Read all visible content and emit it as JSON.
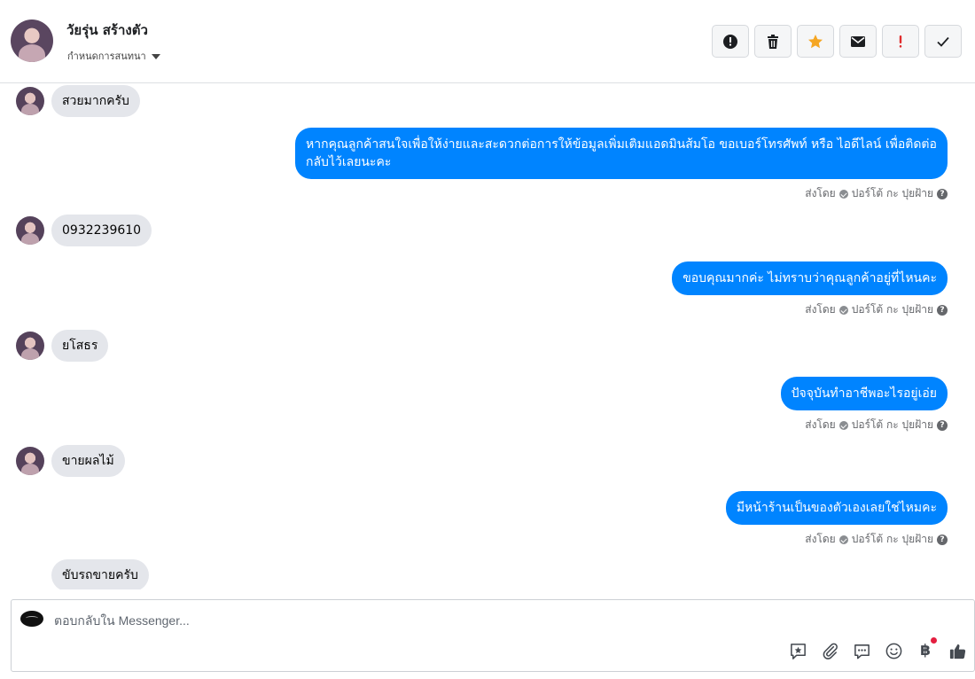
{
  "header": {
    "contact_name": "วัยรุ่น สร้างตัว",
    "assign_label": "กำหนดการสนทนา",
    "tools": [
      {
        "name": "alert-icon",
        "tip": ""
      },
      {
        "name": "trash-icon",
        "tip": ""
      },
      {
        "name": "star-icon",
        "tip": ""
      },
      {
        "name": "envelope-icon",
        "tip": ""
      },
      {
        "name": "exclamation-icon",
        "tip": ""
      },
      {
        "name": "check-icon",
        "tip": ""
      }
    ],
    "colors": {
      "star": "#f5a623",
      "exclamation": "#e02c2c"
    }
  },
  "messages": [
    {
      "dir": "in",
      "text": "สวยมากครับ"
    },
    {
      "dir": "out",
      "text": "หากคุณลูกค้าสนใจเพื่อให้ง่ายและสะดวกต่อการให้ข้อมูลเพิ่มเติมแอดมินส้มโอ ขอเบอร์โทรศัพท์ หรือ ไอดีไลน์ เพื่อติดต่อกลับไว้เลยนะคะ",
      "sent_by": "ส่งโดย",
      "sender": "ปอร์โต้ กะ ปุยฝ้าย"
    },
    {
      "dir": "in",
      "text": "0932239610"
    },
    {
      "dir": "out",
      "text": "ขอบคุณมากค่ะ ไม่ทราบว่าคุณลูกค้าอยู่ที่ไหนคะ",
      "sent_by": "ส่งโดย",
      "sender": "ปอร์โต้ กะ ปุยฝ้าย"
    },
    {
      "dir": "in",
      "text": "ยโสธร"
    },
    {
      "dir": "out",
      "text": "ปัจจุบันทำอาชีพอะไรอยู่เอ่ย",
      "sent_by": "ส่งโดย",
      "sender": "ปอร์โต้ กะ ปุยฝ้าย"
    },
    {
      "dir": "in",
      "text": "ขายผลไม้"
    },
    {
      "dir": "out",
      "text": "มีหน้าร้านเป็นของตัวเองเลยใช่ไหมคะ",
      "sent_by": "ส่งโดย",
      "sender": "ปอร์โต้ กะ ปุยฝ้าย"
    },
    {
      "dir": "in",
      "text": "ขับรถขายครับ"
    }
  ],
  "composer": {
    "placeholder": "ตอบกลับใน Messenger...",
    "baht_symbol": "฿"
  },
  "accent_color": "#0084ff"
}
